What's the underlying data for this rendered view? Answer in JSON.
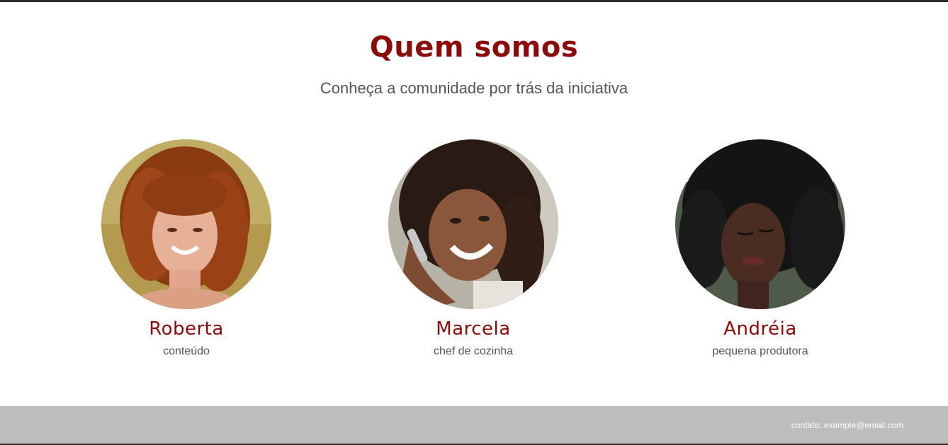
{
  "section": {
    "title": "Quem somos",
    "subtitle": "Conheça a comunidade por trás da iniciativa"
  },
  "members": [
    {
      "name": "Roberta",
      "role": "conteúdo",
      "photo": "portrait-photo"
    },
    {
      "name": "Marcela",
      "role": "chef de cozinha",
      "photo": "portrait-photo"
    },
    {
      "name": "Andréia",
      "role": "pequena produtora",
      "photo": "portrait-photo"
    }
  ],
  "footer": {
    "contact": "contato: example@email.com"
  },
  "colors": {
    "title": "#8b0b0b",
    "text": "#555555",
    "footer_bg": "#bdbdbd",
    "footer_text": "#ffffff"
  }
}
